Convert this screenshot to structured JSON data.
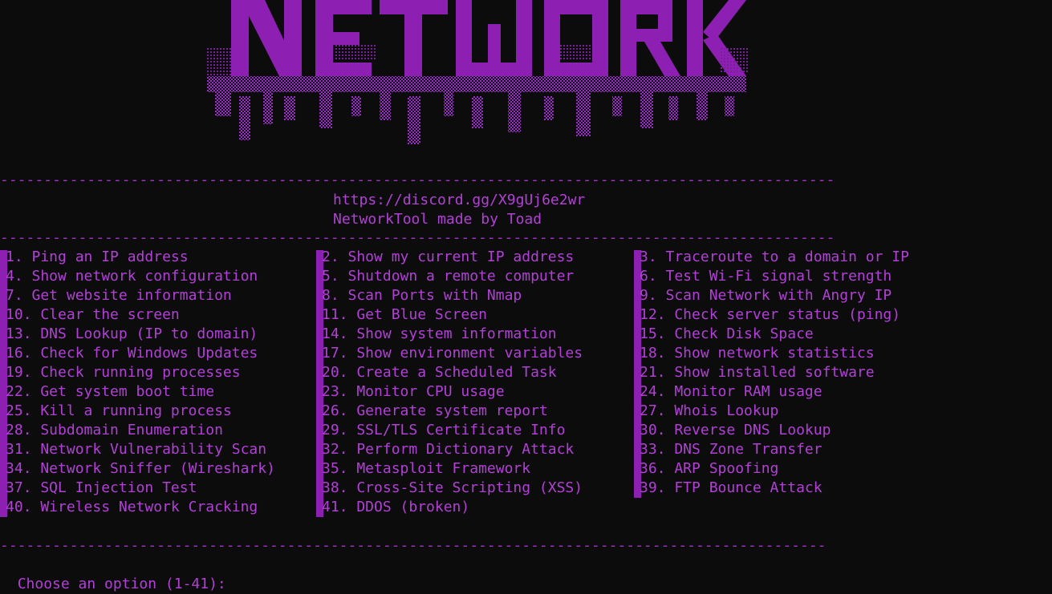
{
  "banner": {
    "logo_text": "NETWORK",
    "color": "#8e1fb3"
  },
  "dividers": {
    "top": "------------------------------------------------------------------------------------------------",
    "middle": "------------------------------------------------------------------------------------------------",
    "bottom": "-----------------------------------------------------------------------------------------------"
  },
  "header": {
    "discord_link": "https://discord.gg/X9gUj6e2wr",
    "credit": "NetworkTool made by Toad"
  },
  "menu": {
    "col1": [
      "1. Ping an IP address",
      "4. Show network configuration",
      "7. Get website information",
      "10. Clear the screen",
      "13. DNS Lookup (IP to domain)",
      "16. Check for Windows Updates",
      "19. Check running processes",
      "22. Get system boot time",
      "25. Kill a running process",
      "28. Subdomain Enumeration",
      "31. Network Vulnerability Scan",
      "34. Network Sniffer (Wireshark)",
      "37. SQL Injection Test",
      "40. Wireless Network Cracking"
    ],
    "col2": [
      "2. Show my current IP address",
      "5. Shutdown a remote computer",
      "8. Scan Ports with Nmap",
      "11. Get Blue Screen",
      "14. Show system information",
      "17. Show environment variables",
      "20. Create a Scheduled Task",
      "23. Monitor CPU usage",
      "26. Generate system report",
      "29. SSL/TLS Certificate Info",
      "32. Perform Dictionary Attack",
      "35. Metasploit Framework",
      "38. Cross-Site Scripting (XSS)",
      "41. DDOS (broken)"
    ],
    "col3": [
      "3. Traceroute to a domain or IP",
      "6. Test Wi-Fi signal strength",
      "9. Scan Network with Angry IP",
      "12. Check server status (ping)",
      "15. Check Disk Space",
      "18. Show network statistics",
      "21. Show installed software",
      "24. Monitor RAM usage",
      "27. Whois Lookup",
      "30. Reverse DNS Lookup",
      "33. DNS Zone Transfer",
      "36. ARP Spoofing",
      "39. FTP Bounce Attack"
    ]
  },
  "prompt": {
    "text": "Choose an option (1-41): "
  }
}
